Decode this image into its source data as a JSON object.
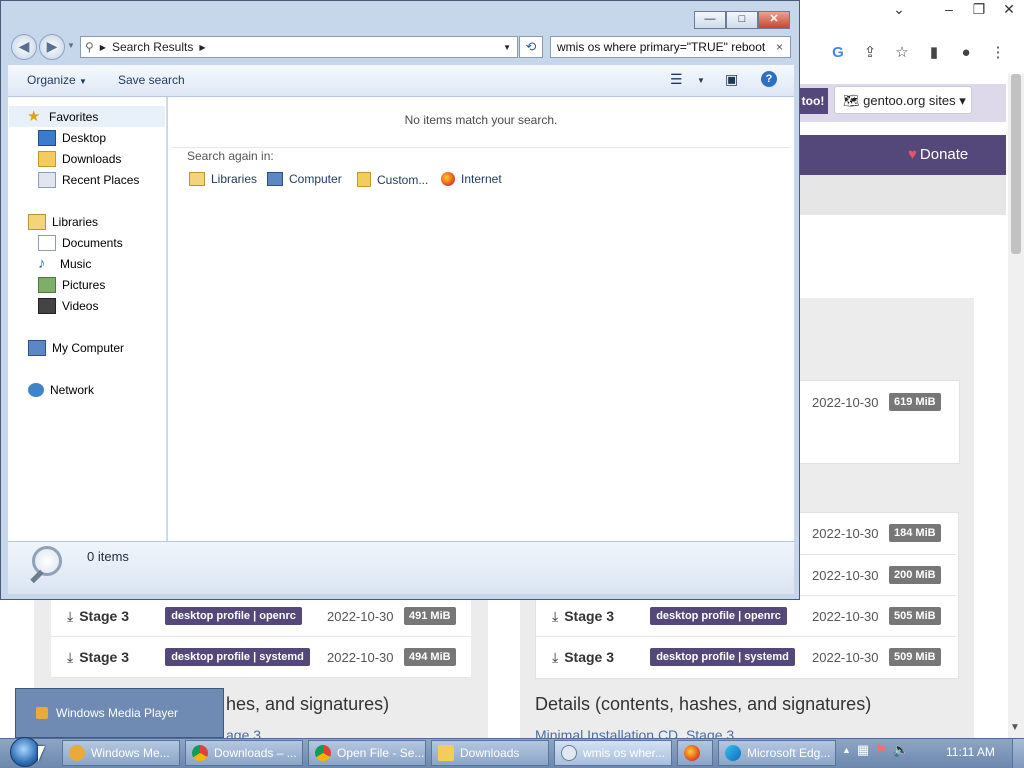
{
  "browser": {
    "gentoo_too": "too!",
    "gentoo_sites": "gentoo.org sites",
    "donate": "Donate",
    "left_rows": [
      {
        "stage": "Stage 3",
        "tag": "desktop profile | openrc",
        "date": "2022-10-30",
        "size": "491 MiB"
      },
      {
        "stage": "Stage 3",
        "tag": "desktop profile | systemd",
        "date": "2022-10-30",
        "size": "494 MiB"
      }
    ],
    "right_top": {
      "date": "2022-10-30",
      "size": "619 MiB"
    },
    "right_rows": [
      {
        "date": "2022-10-30",
        "size": "184 MiB"
      },
      {
        "date": "2022-10-30",
        "size": "200 MiB"
      },
      {
        "stage": "Stage 3",
        "tag": "desktop profile | openrc",
        "date": "2022-10-30",
        "size": "505 MiB"
      },
      {
        "stage": "Stage 3",
        "tag": "desktop profile | systemd",
        "date": "2022-10-30",
        "size": "509 MiB"
      }
    ],
    "left_details": "hes, and signatures)",
    "right_details": "Details (contents, hashes, and signatures)",
    "left_link": "age 3",
    "right_link": "Minimal Installation CD, Stage 3"
  },
  "explorer": {
    "breadcrumb": "Search Results",
    "search_query": "wmis os where primary=\"TRUE\" reboot",
    "organize": "Organize",
    "save_search": "Save search",
    "no_items": "No items match your search.",
    "search_again": "Search again in:",
    "search_locations": [
      "Libraries",
      "Computer",
      "Custom...",
      "Internet"
    ],
    "nav": {
      "favorites": "Favorites",
      "desktop": "Desktop",
      "downloads": "Downloads",
      "recent": "Recent Places",
      "libraries": "Libraries",
      "documents": "Documents",
      "music": "Music",
      "pictures": "Pictures",
      "videos": "Videos",
      "computer": "My Computer",
      "network": "Network"
    },
    "item_count": "0 items"
  },
  "taskbar": {
    "popup_item": "Windows Media Player",
    "buttons": [
      "Windows Me...",
      "Downloads – ...",
      "Open File - Se...",
      "Downloads",
      "wmis os wher...",
      "",
      "Microsoft Edg..."
    ],
    "clock": "11:11 AM"
  },
  "colors": {
    "gentoo_purple": "#54487a",
    "window_frame": "#c6d7ec",
    "taskbar": "#7d97bb"
  }
}
